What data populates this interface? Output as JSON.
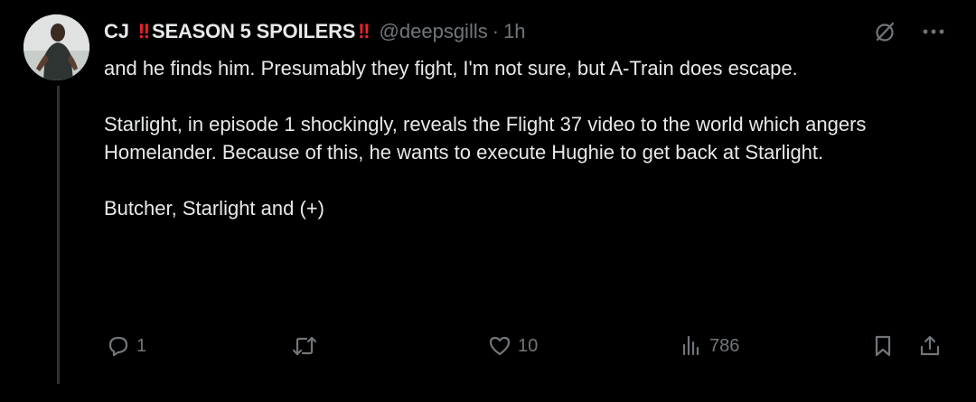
{
  "author": {
    "name": "CJ",
    "emoji_badge": "‼",
    "name_suffix": "SEASON 5 SPOILERS",
    "handle": "@deepsgills",
    "separator": "·",
    "time": "1h"
  },
  "tweet": {
    "paragraphs": [
      "and he finds him. Presumably they fight, I'm not sure, but A-Train does escape.",
      "Starlight, in episode 1 shockingly, reveals the Flight 37 video to the world which angers Homelander. Because of this, he wants to execute Hughie to get back at Starlight.",
      "Butcher, Starlight and (+)"
    ]
  },
  "actions": {
    "reply_count": "1",
    "retweet_count": "",
    "like_count": "10",
    "views_count": "786"
  },
  "icons": {
    "avatar": "profile-photo",
    "grok": "slashed-circle-icon",
    "more": "more-icon",
    "reply": "reply-icon",
    "retweet": "retweet-icon",
    "like": "heart-icon",
    "views": "views-chart-icon",
    "bookmark": "bookmark-icon",
    "share": "share-icon"
  },
  "colors": {
    "background": "#000000",
    "text": "#e7e9ea",
    "muted": "#71767b",
    "emoji_red": "#f4212e",
    "thread_line": "#2f3336"
  }
}
